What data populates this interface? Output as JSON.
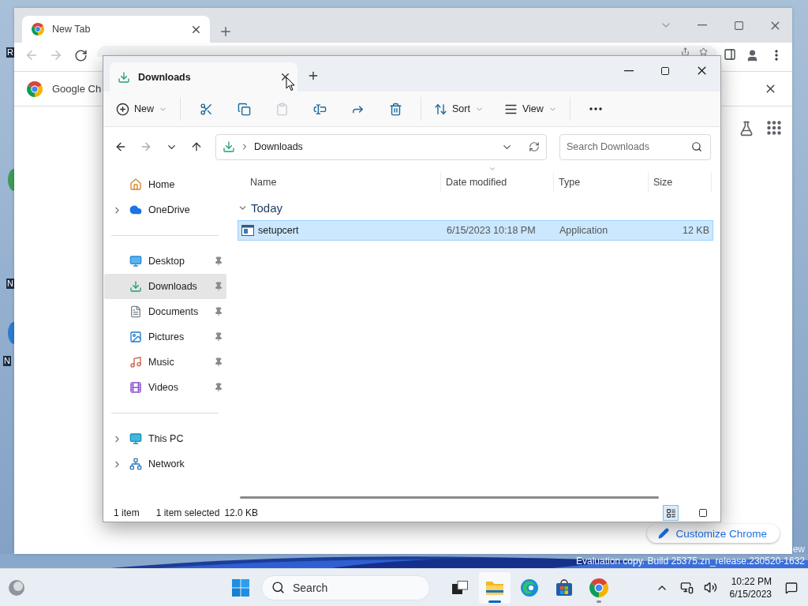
{
  "desktop": {
    "icon_labels": [
      "R",
      "N",
      "N"
    ],
    "watermark": [
      "ew",
      "Evaluation copy. Build 25375.zn_release.230520-1632"
    ]
  },
  "chrome": {
    "tabs": [
      {
        "title": "New Tab",
        "selected": true
      }
    ],
    "infobar": {
      "text": "Google Ch"
    },
    "customize_button": {
      "label": "Customize Chrome"
    }
  },
  "explorer": {
    "tabs": [
      {
        "title": "Downloads",
        "selected": true
      }
    ],
    "toolbar": {
      "new_button": {
        "label": "New"
      },
      "actions": [
        {
          "disabled": false
        },
        {
          "disabled": false
        },
        {
          "disabled": true
        },
        {
          "disabled": false
        },
        {
          "disabled": false
        },
        {
          "disabled": false
        }
      ],
      "sort_button": {
        "label": "Sort"
      },
      "view_button": {
        "label": "View"
      }
    },
    "address": {
      "breadcrumb": [
        "Downloads"
      ],
      "search_placeholder": "Search Downloads"
    },
    "nav_pane": {
      "sections": [
        {
          "items": [
            {
              "label": "Home",
              "expandable": false,
              "pinned": false,
              "selected": false
            },
            {
              "label": "OneDrive",
              "expandable": true,
              "pinned": false,
              "selected": false
            }
          ]
        },
        {
          "items": [
            {
              "label": "Desktop",
              "expandable": false,
              "pinned": true,
              "selected": false
            },
            {
              "label": "Downloads",
              "expandable": false,
              "pinned": true,
              "selected": true
            },
            {
              "label": "Documents",
              "expandable": false,
              "pinned": true,
              "selected": false
            },
            {
              "label": "Pictures",
              "expandable": false,
              "pinned": true,
              "selected": false
            },
            {
              "label": "Music",
              "expandable": false,
              "pinned": true,
              "selected": false
            },
            {
              "label": "Videos",
              "expandable": false,
              "pinned": true,
              "selected": false
            }
          ]
        },
        {
          "items": [
            {
              "label": "This PC",
              "expandable": true,
              "pinned": false,
              "selected": false
            },
            {
              "label": "Network",
              "expandable": true,
              "pinned": false,
              "selected": false
            }
          ]
        }
      ]
    },
    "columns": [
      {
        "label": "Name",
        "sorted": false
      },
      {
        "label": "Date modified",
        "sorted": true
      },
      {
        "label": "Type",
        "sorted": false
      },
      {
        "label": "Size",
        "sorted": false
      }
    ],
    "groups": [
      {
        "label": "Today",
        "expanded": true,
        "rows": [
          {
            "name": "setupcert",
            "date_modified": "6/15/2023 10:18 PM",
            "type": "Application",
            "size": "12 KB",
            "selected": true
          }
        ]
      }
    ],
    "status_bar": {
      "item_count": "1 item",
      "selection": "1 item selected",
      "selection_size": "12.0 KB"
    },
    "view_modes": [
      {
        "selected": true
      },
      {
        "selected": false
      }
    ]
  },
  "taskbar": {
    "search": {
      "placeholder": "Search"
    },
    "apps": [
      {
        "active": false,
        "running": false
      },
      {
        "active": true,
        "running": true
      },
      {
        "active": false,
        "running": false
      },
      {
        "active": false,
        "running": false
      },
      {
        "active": false,
        "running": true
      }
    ],
    "clock": {
      "time": "10:22 PM",
      "date": "6/15/2023"
    }
  }
}
